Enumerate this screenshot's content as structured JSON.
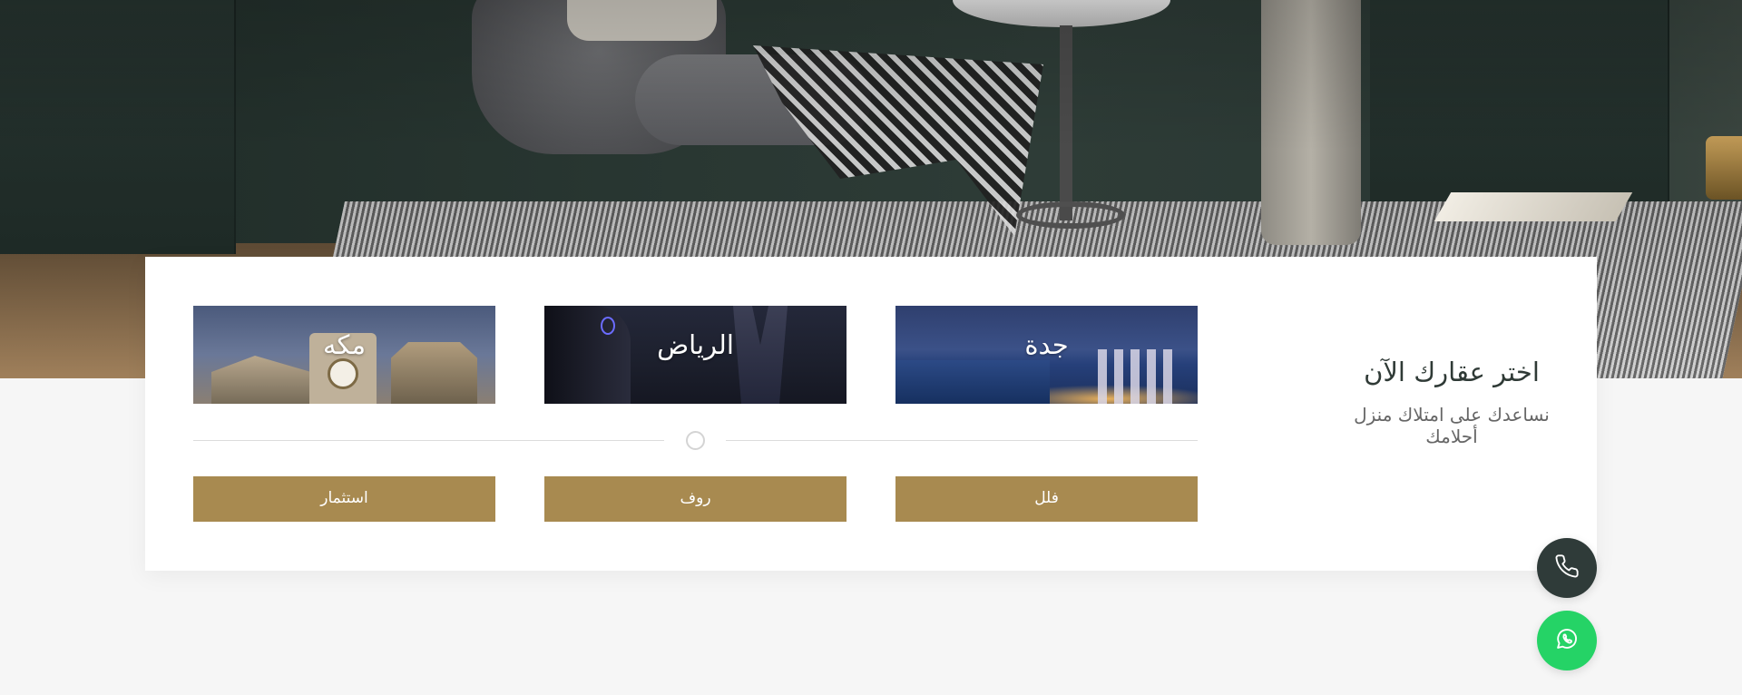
{
  "hero": {
    "image": "living-room-chair-photo"
  },
  "search_card": {
    "heading": "اختر عقارك الآن",
    "subheading": "نساعدك على امتلاك منزل أحلامك",
    "cities": [
      {
        "name": "جدة",
        "image": "jeddah-night-skyline"
      },
      {
        "name": "الرياض",
        "image": "riyadh-night-skyline"
      },
      {
        "name": "مكه",
        "image": "makkah-clock-tower"
      }
    ],
    "property_types": [
      {
        "label": "فلل"
      },
      {
        "label": "روف"
      },
      {
        "label": "استثمار"
      }
    ],
    "colors": {
      "button_bg": "#a88a50",
      "button_text": "#ffffff",
      "heading": "#2f3a36"
    }
  },
  "floating_actions": {
    "phone_icon": "phone-icon",
    "whatsapp_icon": "whatsapp-icon",
    "colors": {
      "phone_bg": "#2f3b39",
      "whatsapp_bg": "#25d366"
    }
  }
}
